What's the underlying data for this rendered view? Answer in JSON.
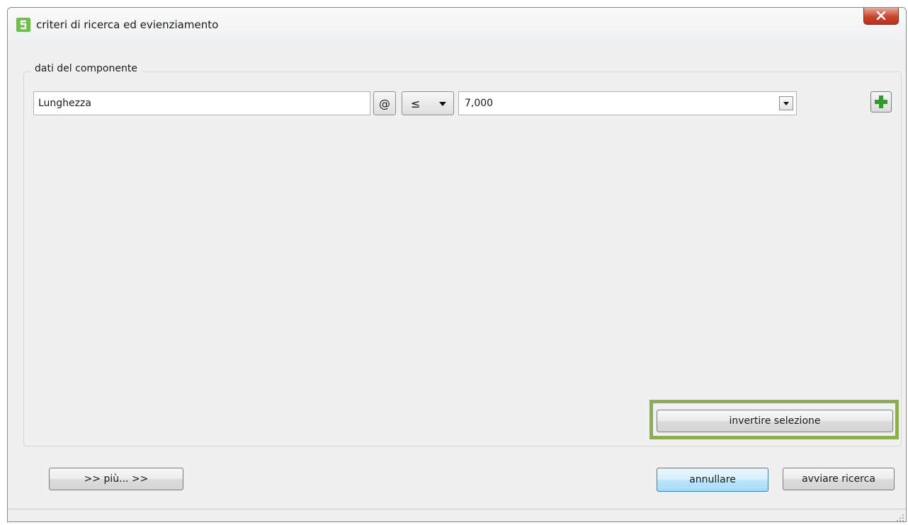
{
  "window": {
    "title": "criteri di ricerca ed evienziamento",
    "close_label": "X"
  },
  "group": {
    "legend": "dati del componente"
  },
  "criteria": {
    "field_value": "Lunghezza",
    "at_symbol": "@",
    "operator": "≤",
    "value": "7,000"
  },
  "buttons": {
    "invert_selection": "invertire selezione",
    "more": ">> più... >>",
    "cancel": "annullare",
    "start_search": "avviare ricerca"
  },
  "icons": {
    "app": "app-logo-icon",
    "add": "plus-icon",
    "close": "close-icon"
  },
  "colors": {
    "accent_green": "#6cc04a",
    "highlight_border": "#8cae50",
    "close_red": "#c7452e"
  }
}
